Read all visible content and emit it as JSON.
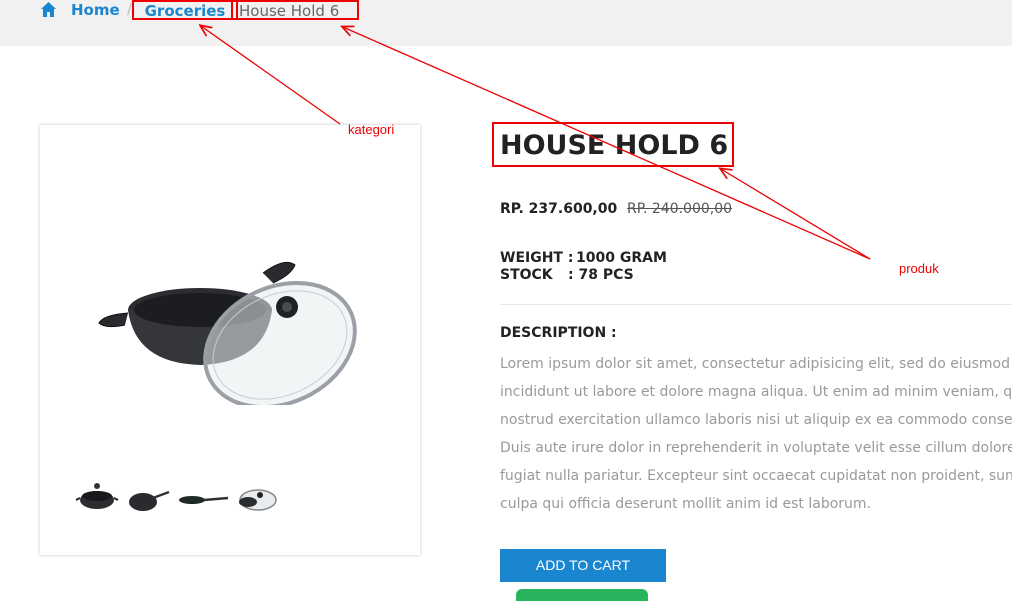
{
  "breadcrumb": {
    "home": "Home",
    "separator": "/",
    "category": "Groceries",
    "product": "House Hold 6"
  },
  "product": {
    "title": "HOUSE HOLD 6",
    "price": "RP. 237.600,00",
    "price_old": "RP. 240.000,00",
    "weight_label": "WEIGHT :",
    "weight_value": "1000 GRAM",
    "stock_label": "STOCK",
    "stock_value": ": 78 PCS",
    "description_heading": "DESCRIPTION :",
    "description_lines": [
      "Lorem ipsum dolor sit amet, consectetur adipisicing elit, sed do eiusmod tempo",
      "incididunt ut labore et dolore magna aliqua. Ut enim ad minim veniam, quis",
      "nostrud exercitation ullamco laboris nisi ut aliquip ex ea commodo consequat.",
      "Duis aute irure dolor in reprehenderit in voluptate velit esse cillum dolore eu",
      "fugiat nulla pariatur. Excepteur sint occaecat cupidatat non proident, sunt in",
      "culpa qui officia deserunt mollit anim id est laborum."
    ],
    "add_to_cart": "ADD TO CART"
  },
  "annotations": {
    "category_note": "kategori",
    "product_note": "produk"
  },
  "colors": {
    "link": "#1a86d0",
    "button": "#1a86d0",
    "annotation": "#ee0000"
  }
}
